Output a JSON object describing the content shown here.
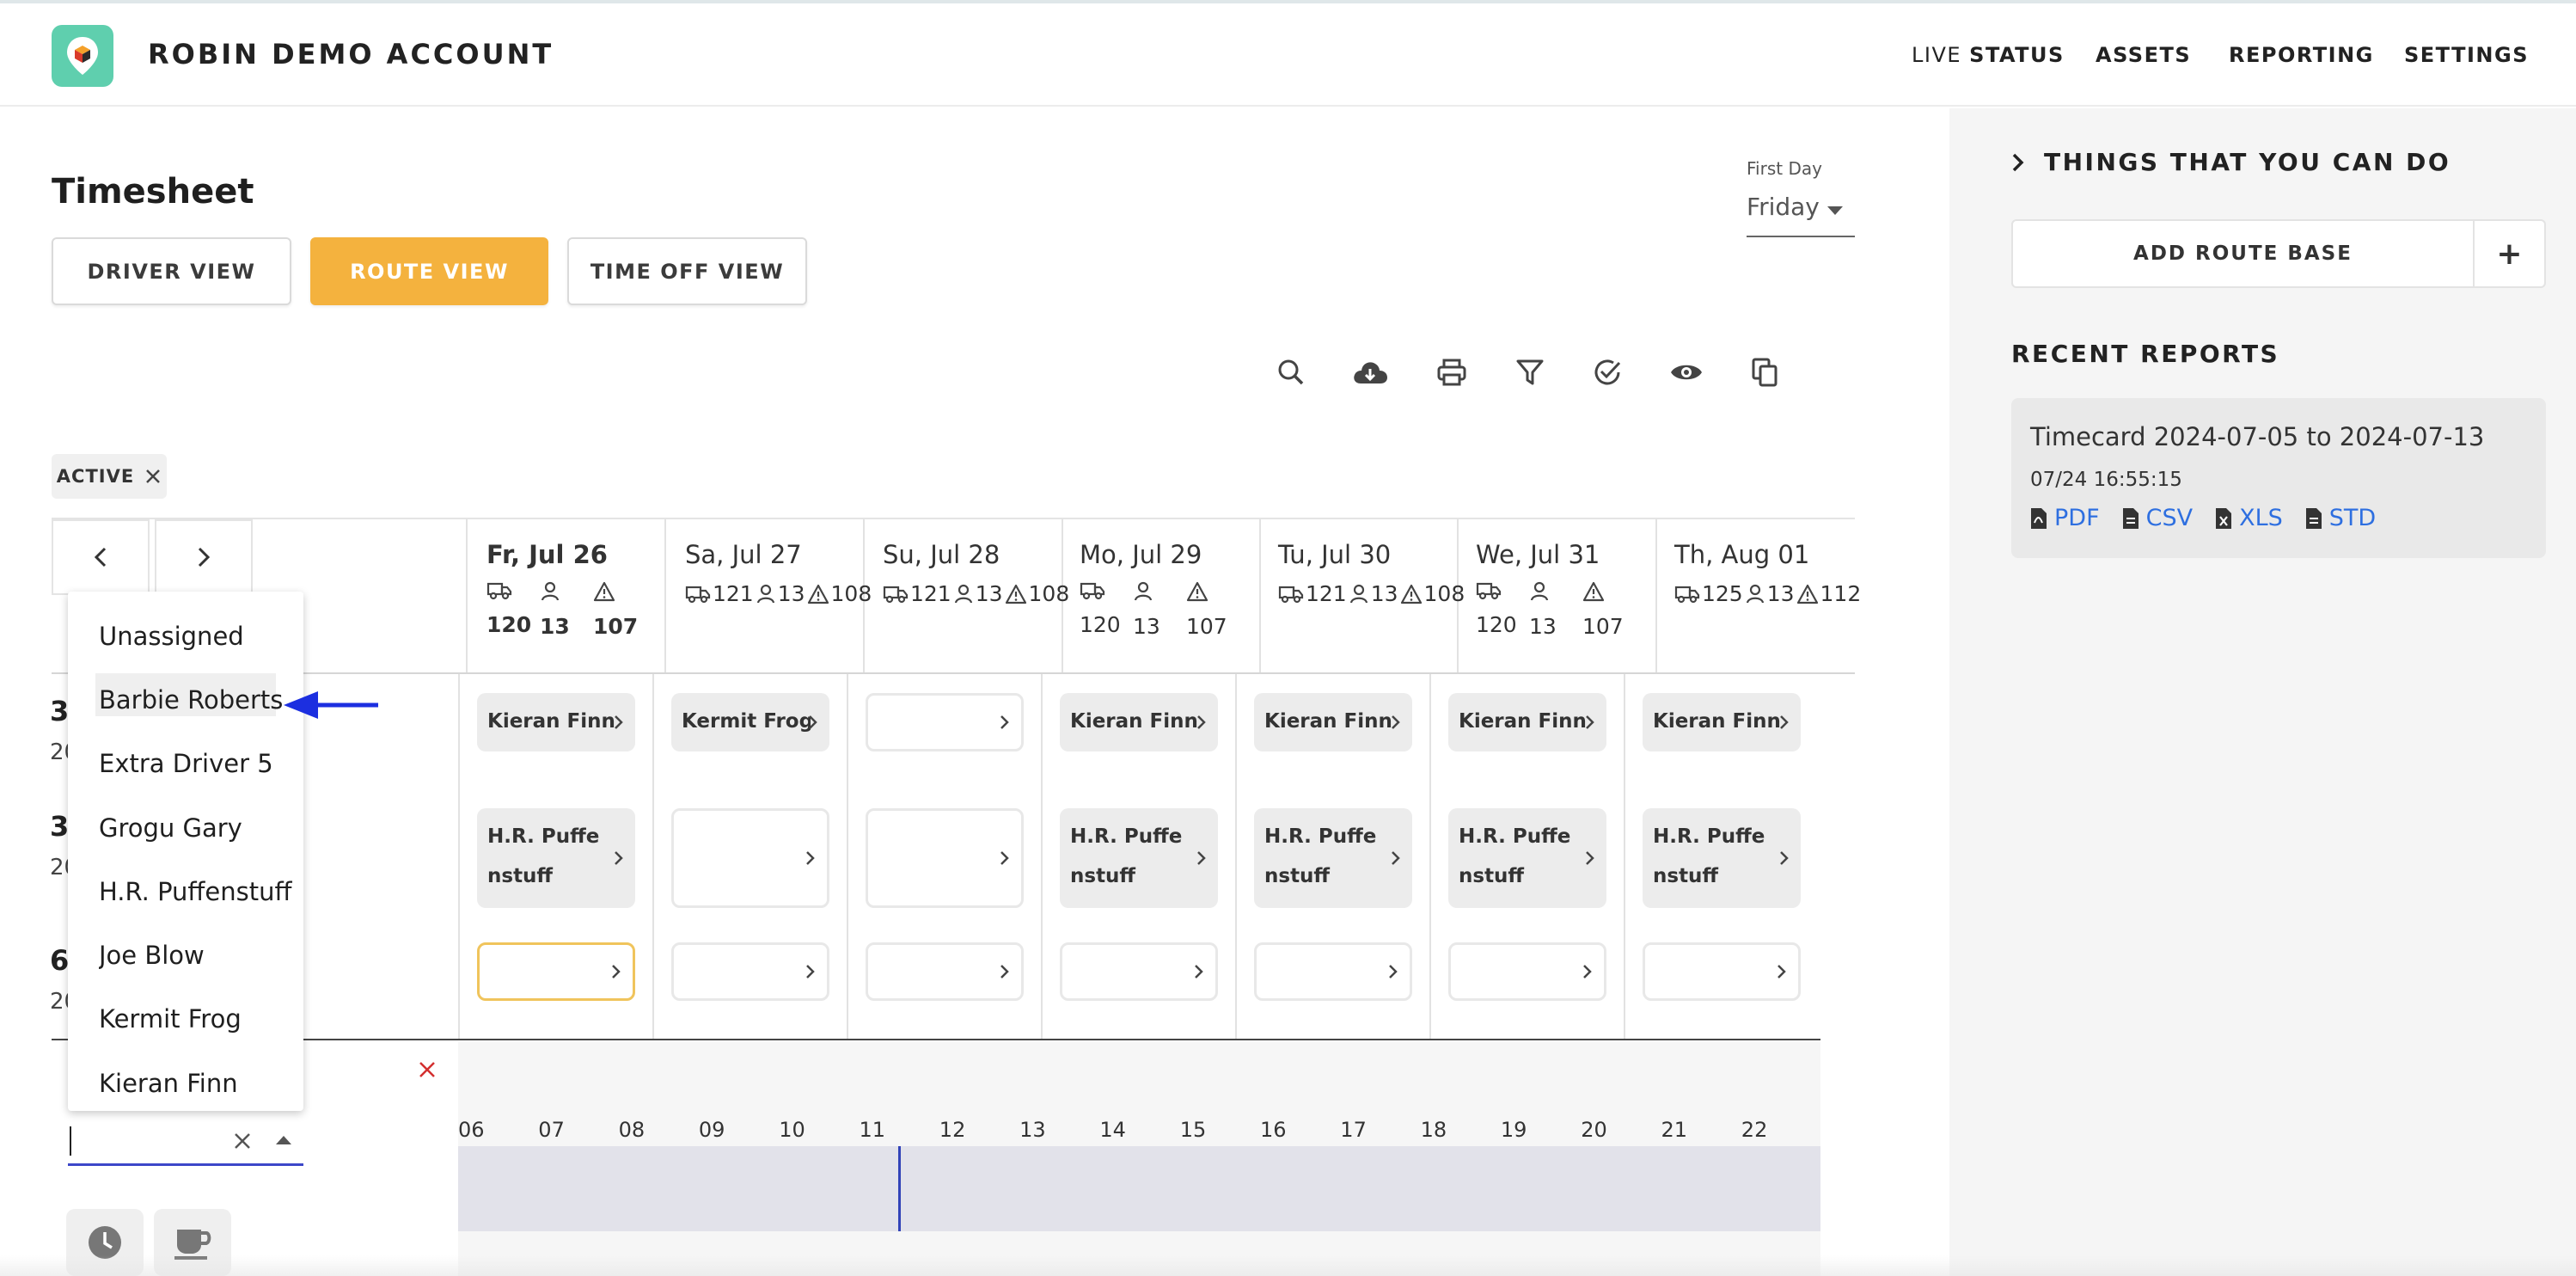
{
  "app": {
    "account_name": "ROBIN DEMO ACCOUNT"
  },
  "nav": {
    "live_status_prefix": "LIVE ",
    "live_status_main": "STATUS",
    "assets": "ASSETS",
    "reporting": "REPORTING",
    "settings": "SETTINGS"
  },
  "page": {
    "title": "Timesheet",
    "views": [
      "DRIVER VIEW",
      "ROUTE VIEW",
      "TIME OFF VIEW"
    ],
    "active_view": "ROUTE VIEW",
    "first_day_label": "First Day",
    "first_day_value": "Friday"
  },
  "toolbar": {
    "icons": [
      "search-icon",
      "cloud-download-icon",
      "printer-icon",
      "filter-icon",
      "check-circle-icon",
      "eye-icon",
      "copy-icon"
    ]
  },
  "filter_chip": {
    "label": "ACTIVE"
  },
  "days": [
    {
      "label": "Fr, Jul 26",
      "trucks": "120",
      "people": "13",
      "alerts": "107",
      "layout": "stacked",
      "bold": true
    },
    {
      "label": "Sa, Jul 27",
      "trucks": "121",
      "people": "13",
      "alerts": "108",
      "layout": "inline",
      "bold": false
    },
    {
      "label": "Su, Jul 28",
      "trucks": "121",
      "people": "13",
      "alerts": "108",
      "layout": "inline",
      "bold": false
    },
    {
      "label": "Mo, Jul 29",
      "trucks": "120",
      "people": "13",
      "alerts": "107",
      "layout": "stacked",
      "bold": false
    },
    {
      "label": "Tu, Jul 30",
      "trucks": "121",
      "people": "13",
      "alerts": "108",
      "layout": "inline",
      "bold": false
    },
    {
      "label": "We, Jul 31",
      "trucks": "120",
      "people": "13",
      "alerts": "107",
      "layout": "stacked",
      "bold": false
    },
    {
      "label": "Th, Aug 01",
      "trucks": "125",
      "people": "13",
      "alerts": "112",
      "layout": "inline",
      "bold": false
    }
  ],
  "rows": [
    {
      "label": "3",
      "sub": "20",
      "cells": [
        "Kieran Finn",
        "Kermit Frog",
        "",
        "Kieran Finn",
        "Kieran Finn",
        "Kieran Finn",
        "Kieran Finn"
      ]
    },
    {
      "label": "3",
      "sub": "20",
      "cells": [
        "H.R. Puffenstuff",
        "",
        "",
        "H.R. Puffenstuff",
        "H.R. Puffenstuff",
        "H.R. Puffenstuff",
        "H.R. Puffenstuff"
      ]
    },
    {
      "label": "6",
      "sub": "20",
      "cells": [
        "",
        "",
        "",
        "",
        "",
        "",
        ""
      ]
    }
  ],
  "dropdown": {
    "options": [
      "Unassigned",
      "Barbie Roberts",
      "Extra Driver 5",
      "Grogu Gary",
      "H.R. Puffenstuff",
      "Joe Blow",
      "Kermit Frog",
      "Kieran Finn"
    ],
    "highlighted": "Barbie Roberts",
    "input_value": ""
  },
  "timeline": {
    "hours": [
      "06",
      "07",
      "08",
      "09",
      "10",
      "11",
      "12",
      "13",
      "14",
      "15",
      "16",
      "17",
      "18",
      "19",
      "20",
      "21",
      "22"
    ]
  },
  "side_panel": {
    "things_title": "THINGS THAT YOU CAN DO",
    "add_route_base": "ADD ROUTE BASE",
    "add_plus": "+",
    "recent_reports_title": "RECENT REPORTS",
    "report": {
      "title": "Timecard 2024-07-05 to 2024-07-13",
      "date": "07/24 16:55:15",
      "links": [
        "PDF",
        "CSV",
        "XLS",
        "STD"
      ]
    }
  },
  "colors": {
    "accent": "#f4b23e",
    "link": "#2e6fe0",
    "brand": "#5fcfae",
    "focus": "#3c47c9",
    "danger": "#d32f2f"
  }
}
